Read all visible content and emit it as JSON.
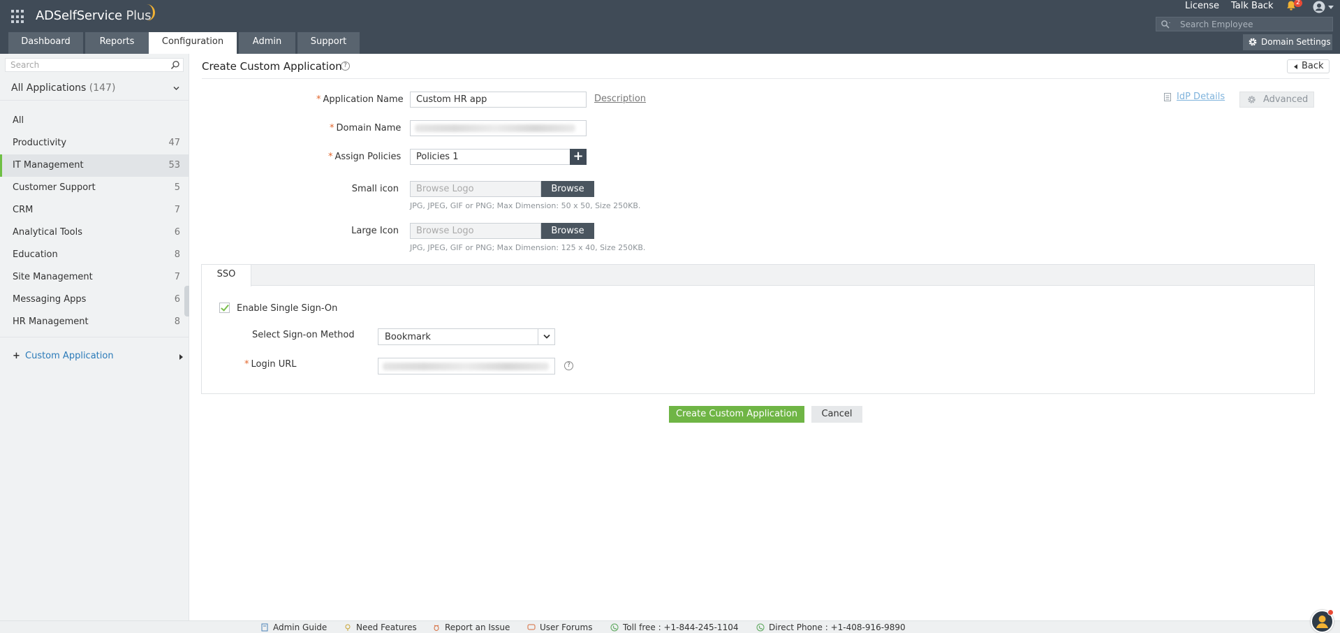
{
  "header": {
    "brand_name": "ADSelfService",
    "brand_suffix": "Plus",
    "license": "License",
    "talk_back": "Talk Back",
    "notification_count": "2",
    "search_employee_placeholder": "Search Employee",
    "domain_settings": "Domain Settings",
    "tabs": [
      {
        "label": "Dashboard",
        "active": false
      },
      {
        "label": "Reports",
        "active": false
      },
      {
        "label": "Configuration",
        "active": true
      },
      {
        "label": "Admin",
        "active": false
      },
      {
        "label": "Support",
        "active": false
      }
    ],
    "colors": {
      "header_bg": "#404b57",
      "tab_bg": "#59646f",
      "accent": "#6fbf44"
    }
  },
  "sidebar": {
    "search_placeholder": "Search",
    "all_apps_label": "All Applications",
    "all_apps_count": "(147)",
    "items": [
      {
        "label": "All",
        "count": ""
      },
      {
        "label": "Productivity",
        "count": "47"
      },
      {
        "label": "IT Management",
        "count": "53",
        "active": true
      },
      {
        "label": "Customer Support",
        "count": "5"
      },
      {
        "label": "CRM",
        "count": "7"
      },
      {
        "label": "Analytical Tools",
        "count": "6"
      },
      {
        "label": "Education",
        "count": "8"
      },
      {
        "label": "Site Management",
        "count": "7"
      },
      {
        "label": "Messaging Apps",
        "count": "6"
      },
      {
        "label": "HR Management",
        "count": "8"
      }
    ],
    "custom_application": "Custom Application"
  },
  "main": {
    "title": "Create Custom Application",
    "back": "Back",
    "idp_details": "IdP Details",
    "advanced": "Advanced",
    "description_link": "Description",
    "form": {
      "app_name_label": "Application Name",
      "app_name_value": "Custom HR app",
      "domain_name_label": "Domain Name",
      "assign_policies_label": "Assign Policies",
      "assign_policies_value": "Policies 1",
      "small_icon_label": "Small icon",
      "large_icon_label": "Large Icon",
      "browse_placeholder": "Browse Logo",
      "browse_button": "Browse",
      "small_icon_hint": "JPG, JPEG, GIF or PNG; Max Dimension: 50 x 50, Size 250KB.",
      "large_icon_hint": "JPG, JPEG, GIF or PNG; Max Dimension: 125 x 40, Size 250KB."
    },
    "sso": {
      "tab_label": "SSO",
      "enable_label": "Enable Single Sign-On",
      "enabled": true,
      "method_label": "Select Sign-on Method",
      "method_value": "Bookmark",
      "login_url_label": "Login URL"
    },
    "create_button": "Create Custom Application",
    "cancel_button": "Cancel"
  },
  "footer": {
    "admin_guide": "Admin Guide",
    "need_features": "Need Features",
    "report_issue": "Report an Issue",
    "user_forums": "User Forums",
    "toll_free": "Toll free : +1-844-245-1104",
    "direct_phone": "Direct Phone : +1-408-916-9890"
  }
}
